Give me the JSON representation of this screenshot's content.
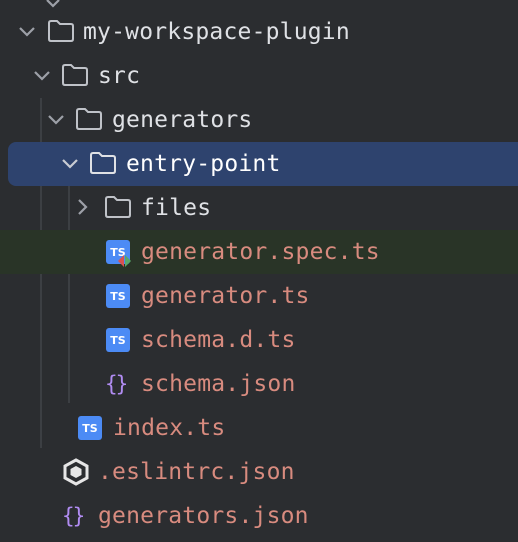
{
  "tree": {
    "items": [
      {
        "label": "my-workspace-plugin",
        "kind": "folder",
        "expanded": true,
        "icon": "folder-icon"
      },
      {
        "label": "src",
        "kind": "folder",
        "expanded": true,
        "icon": "folder-icon"
      },
      {
        "label": "generators",
        "kind": "folder",
        "expanded": true,
        "icon": "folder-icon"
      },
      {
        "label": "entry-point",
        "kind": "folder",
        "expanded": true,
        "selected": true,
        "icon": "folder-icon"
      },
      {
        "label": "files",
        "kind": "folder",
        "expanded": false,
        "icon": "folder-icon"
      },
      {
        "label": "generator.spec.ts",
        "kind": "file",
        "badge": "TS",
        "modified": true,
        "icon": "typescript-test-icon"
      },
      {
        "label": "generator.ts",
        "kind": "file",
        "badge": "TS",
        "icon": "typescript-icon"
      },
      {
        "label": "schema.d.ts",
        "kind": "file",
        "badge": "TS",
        "icon": "typescript-icon"
      },
      {
        "label": "schema.json",
        "kind": "file",
        "badge": "{}",
        "icon": "json-icon"
      },
      {
        "label": "index.ts",
        "kind": "file",
        "badge": "TS",
        "icon": "typescript-icon"
      },
      {
        "label": ".eslintrc.json",
        "kind": "file",
        "icon": "eslint-icon"
      },
      {
        "label": "generators.json",
        "kind": "file",
        "badge": "{}",
        "icon": "json-icon"
      }
    ]
  },
  "colors": {
    "background": "#2b2d30",
    "selected_row": "#2e436e",
    "modified_row": "#293427",
    "file_text": "#d88b7f",
    "folder_text": "#dfe1e5",
    "ts_badge": "#4c8bf5",
    "json_icon": "#b18cf2"
  }
}
